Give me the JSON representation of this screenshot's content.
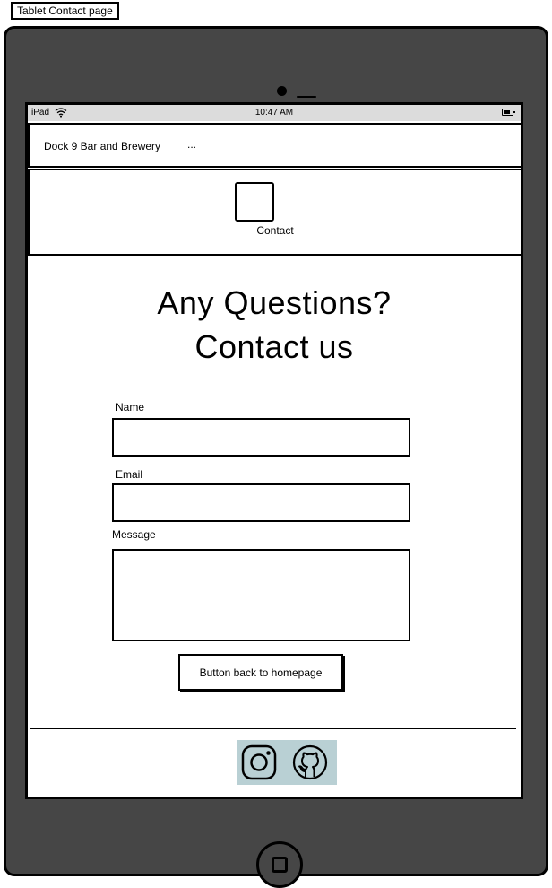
{
  "frame_label": "Tablet Contact page",
  "status_bar": {
    "device": "iPad",
    "time": "10:47 AM",
    "wifi_icon": "wifi-icon",
    "battery_icon": "battery-icon"
  },
  "navbar": {
    "brand": "Dock 9 Bar and Brewery",
    "more": "...",
    "menu_icon": "hamburger-menu-icon"
  },
  "header": {
    "image_icon": "image-placeholder-icon",
    "caption": "Contact"
  },
  "main": {
    "heading_line1": "Any Questions?",
    "heading_line2": "Contact us"
  },
  "form": {
    "name_label": "Name",
    "email_label": "Email",
    "message_label": "Message",
    "button_label": "Button back to homepage"
  },
  "footer": {
    "social": [
      {
        "icon": "instagram-icon"
      },
      {
        "icon": "github-icon"
      }
    ],
    "background": "#b9d0d4"
  },
  "colors": {
    "tablet_body": "#464646",
    "status_bar": "#dcdcdc",
    "screen": "#ffffff"
  }
}
